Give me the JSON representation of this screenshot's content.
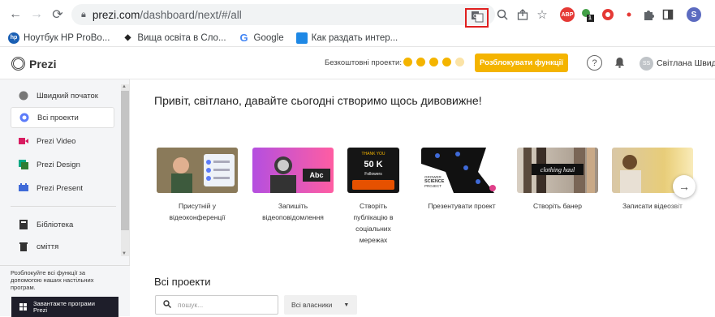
{
  "browser": {
    "url_host": "prezi.com",
    "url_path": "/dashboard/next/#/all",
    "bookmarks": [
      {
        "label": "Ноутбук HP ProBo...",
        "icon": "hp-icon"
      },
      {
        "label": "Вища освіта в Сло...",
        "icon": "mortarboard-icon"
      },
      {
        "label": "Google",
        "icon": "google-icon"
      },
      {
        "label": "Как раздать интер...",
        "icon": "bag-icon"
      }
    ],
    "profile_initial": "S",
    "ext_badge": "1"
  },
  "header": {
    "logo_text": "Prezi",
    "free_projects_label": "Безкоштовні проекти:",
    "unlock_button": "Розблокувати функції",
    "help": "?",
    "avatar_initials": "SS",
    "user_name": "Світлана Швидка"
  },
  "sidebar": {
    "items": [
      {
        "label": "Швидкий початок",
        "icon": "quickstart-icon"
      },
      {
        "label": "Всі проекти",
        "icon": "all-projects-icon"
      },
      {
        "label": "Prezi Video",
        "icon": "video-icon"
      },
      {
        "label": "Prezi Design",
        "icon": "design-icon"
      },
      {
        "label": "Prezi Present",
        "icon": "present-icon"
      },
      {
        "label": "Бібліотека",
        "icon": "library-icon"
      },
      {
        "label": "сміття",
        "icon": "trash-icon"
      }
    ],
    "footer_text": "Розблокуйте всі функції за допомогою наших настільних програм.",
    "download_label_1": "Завантажте програми",
    "download_label_2": "Prezi"
  },
  "main": {
    "greeting": "Привіт, світлано, давайте сьогодні створимо щось дивовижне!",
    "cards": [
      {
        "label": "Присутній у відеоконференції"
      },
      {
        "label": "Запишіть відеоповідомлення",
        "thumb_text": "Abc"
      },
      {
        "label": "Створіть публікацію в соціальних мережах",
        "thumb_text_1": "THANK YOU",
        "thumb_text_2": "50 K",
        "thumb_text_3": "Followers"
      },
      {
        "label": "Презентувати проект",
        "thumb_text_1": "GROWER",
        "thumb_text_2": "SCIENCE",
        "thumb_text_3": "PROJECT"
      },
      {
        "label": "Створіть банер",
        "thumb_text": "clothing haul"
      },
      {
        "label": "Записати відеозвіт"
      }
    ],
    "all_projects_title": "Всі проекти",
    "search_placeholder": "пошук...",
    "owners_select": "Всі власники"
  },
  "colors": {
    "accent": "#f4b400",
    "sidebar_bg": "#f4f5f7",
    "dark_button": "#1e1e2a"
  }
}
